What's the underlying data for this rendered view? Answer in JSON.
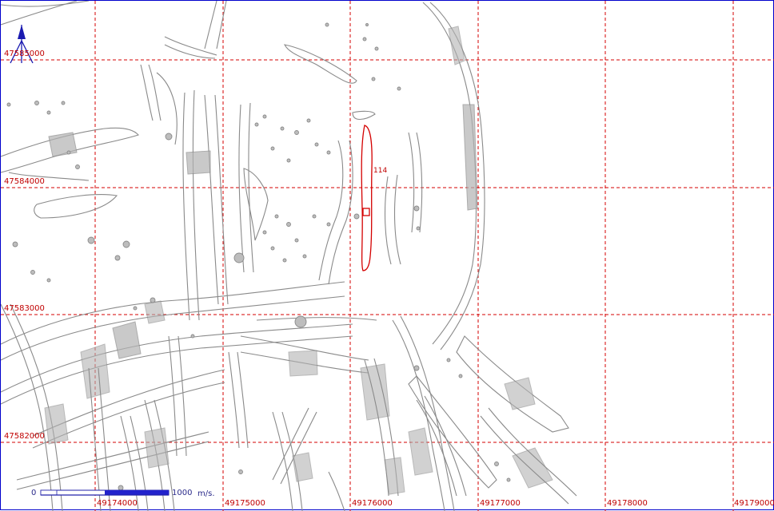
{
  "map": {
    "north_arrow_icon": "north-arrow-icon",
    "grid_color": "#d40000",
    "feature_color": "#8a8a8a",
    "highlight_color": "#d40000",
    "frame_color": "#0000cc",
    "x_labels": [
      "49174000",
      "49175000",
      "49176000",
      "49177000",
      "49178000",
      "49179000"
    ],
    "y_labels": [
      "47585000",
      "47584000",
      "47583000",
      "47582000"
    ],
    "feature_label": "114",
    "scale": {
      "start": "0",
      "end": "1000",
      "unit": "m/s."
    }
  }
}
